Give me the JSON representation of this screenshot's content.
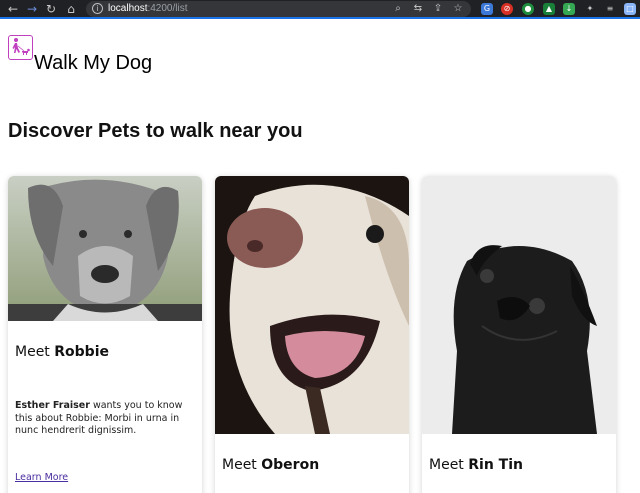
{
  "browser": {
    "url_host": "localhost",
    "url_path": ":4200/list"
  },
  "app": {
    "title": "Walk My Dog",
    "logo_icon": "person-walking-dog-icon"
  },
  "page": {
    "heading": "Discover Pets to walk near you"
  },
  "pets": [
    {
      "meet_prefix": "Meet",
      "name": "Robbie",
      "owner": "Esther Fraiser",
      "description": "wants you to know this about Robbie: Morbi in urna in nunc hendrerit dignissim.",
      "link_label": "Learn More"
    },
    {
      "meet_prefix": "Meet",
      "name": "Oberon"
    },
    {
      "meet_prefix": "Meet",
      "name": "Rin Tin"
    }
  ],
  "colors": {
    "accent": "#1a73e8",
    "logo": "#c040c0",
    "link": "#4b2ea0"
  }
}
